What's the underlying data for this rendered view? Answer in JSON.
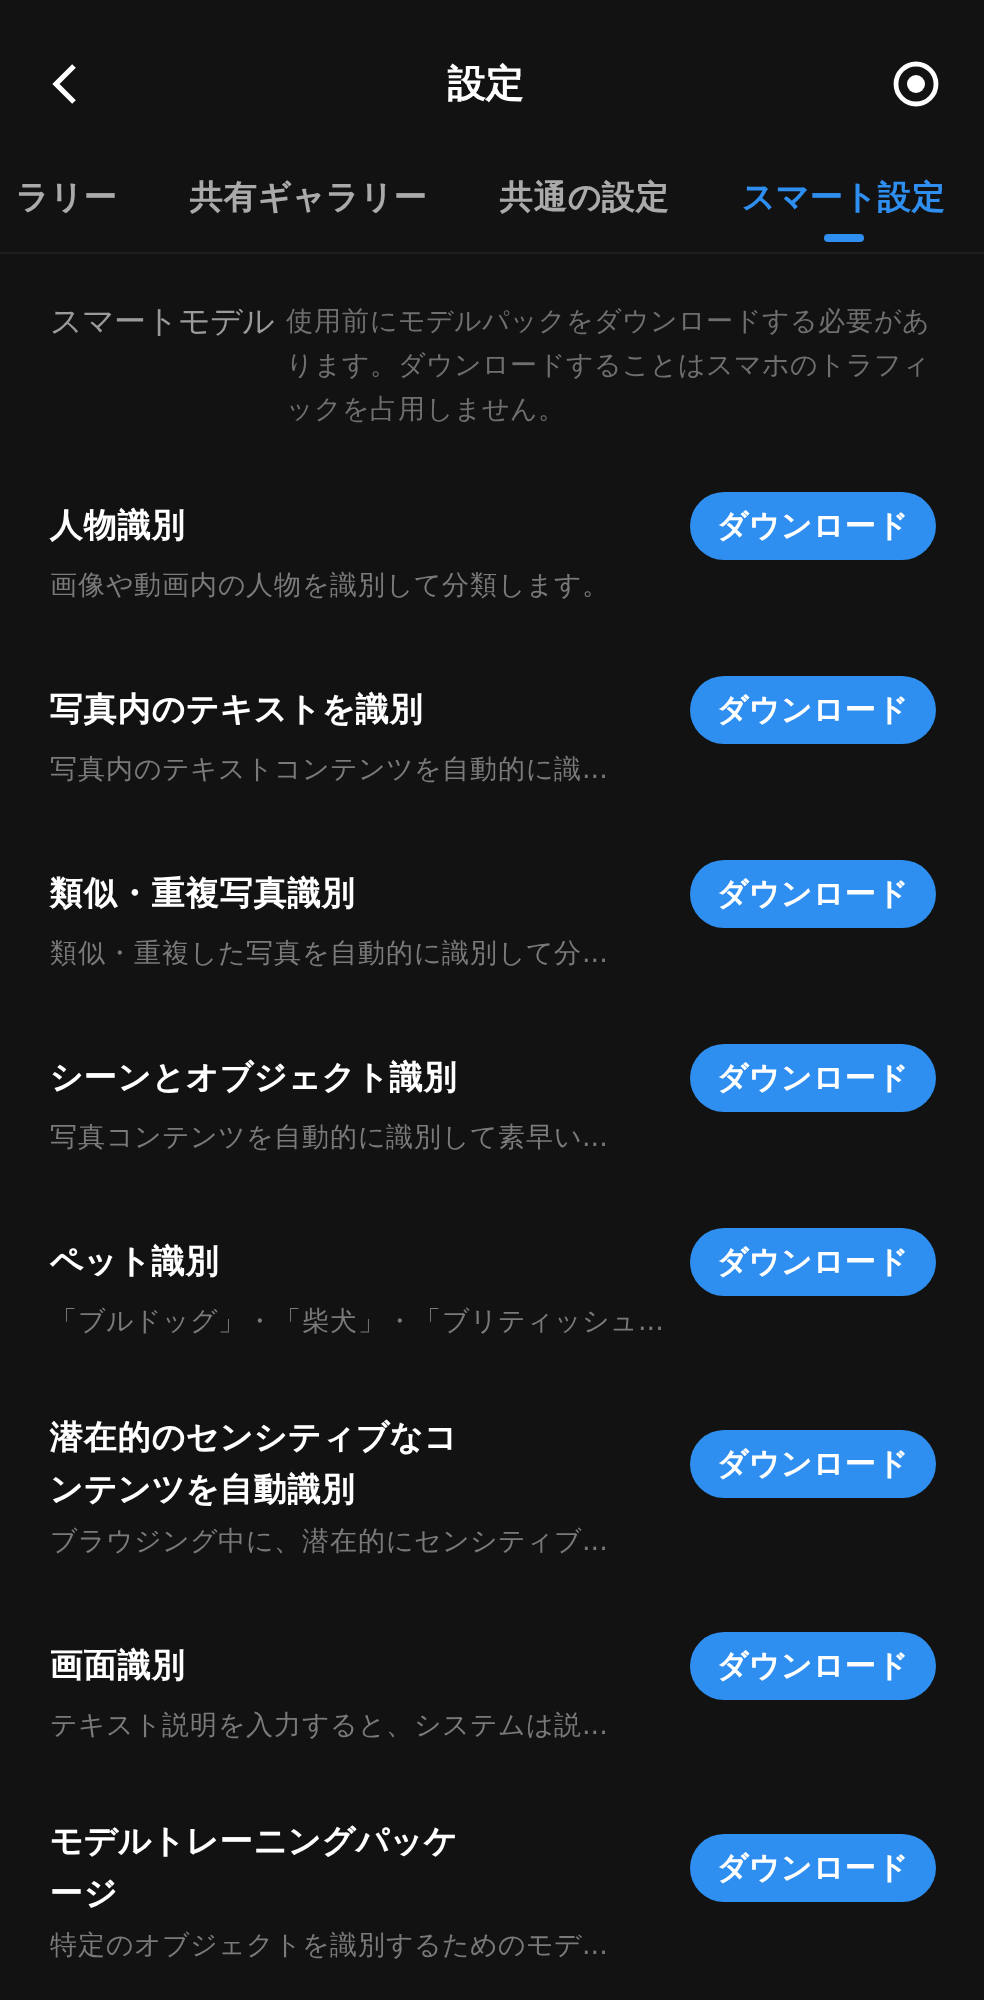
{
  "header": {
    "title": "設定"
  },
  "tabs": [
    {
      "label": "ラリー",
      "selected": false
    },
    {
      "label": "共有ギャラリー",
      "selected": false
    },
    {
      "label": "共通の設定",
      "selected": false
    },
    {
      "label": "スマート設定",
      "selected": true
    }
  ],
  "intro": {
    "label": "スマートモデル",
    "text": "使用前にモデルパックをダウンロードする必要があります。ダウンロードすることはスマホのトラフィックを占用しません。"
  },
  "models": [
    {
      "title": "人物識別",
      "description": "画像や動画内の人物を識別して分類します。",
      "button": "ダウンロード"
    },
    {
      "title": "写真内のテキストを識別",
      "description": "写真内のテキストコンテンツを自動的に識...",
      "button": "ダウンロード"
    },
    {
      "title": "類似・重複写真識別",
      "description": "類似・重複した写真を自動的に識別して分...",
      "button": "ダウンロード"
    },
    {
      "title": "シーンとオブジェクト識別",
      "description": "写真コンテンツを自動的に識別して素早い...",
      "button": "ダウンロード"
    },
    {
      "title": "ペット識別",
      "description": "「ブルドッグ」・「柴犬」・「ブリティッシュ...",
      "button": "ダウンロード"
    },
    {
      "title": "潜在的のセンシティブなコンテンツを自動識別",
      "description": "ブラウジング中に、潜在的にセンシティブ...",
      "button": "ダウンロード"
    },
    {
      "title": "画面識別",
      "description": "テキスト説明を入力すると、システムは説...",
      "button": "ダウンロード"
    },
    {
      "title": "モデルトレーニングパッケージ",
      "description": "特定のオブジェクトを識別するためのモデ...",
      "button": "ダウンロード"
    }
  ]
}
